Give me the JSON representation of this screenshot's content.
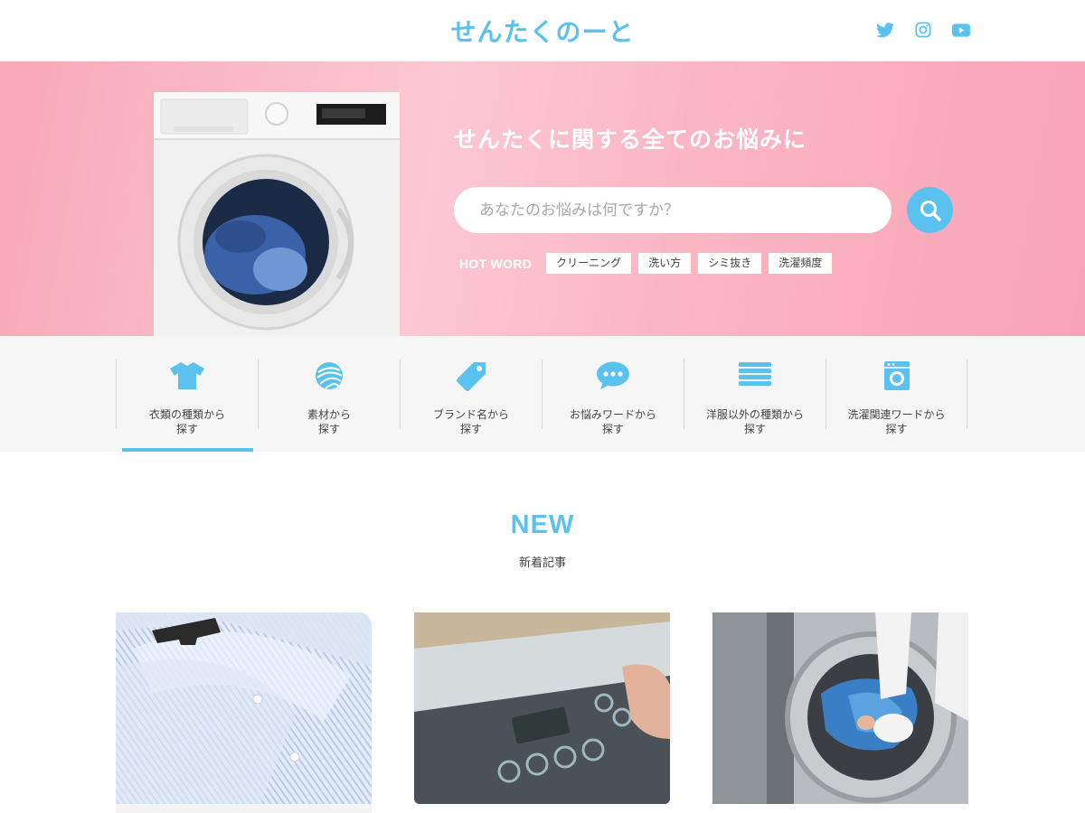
{
  "header": {
    "logo": "せんたくのーと",
    "social": [
      {
        "icon": "twitter-icon"
      },
      {
        "icon": "instagram-icon"
      },
      {
        "icon": "youtube-icon"
      }
    ]
  },
  "hero": {
    "title": "せんたくに関する全てのお悩みに",
    "search_placeholder": "あなたのお悩みは何ですか？",
    "hot_word_label": "HOT WORD",
    "hot_words": [
      "クリーニング",
      "洗い方",
      "シミ抜き",
      "洗濯頻度"
    ]
  },
  "categories": [
    {
      "icon": "tshirt-icon",
      "label": "衣類の種類から\n探す"
    },
    {
      "icon": "yarn-ball-icon",
      "label": "素材から\n探す"
    },
    {
      "icon": "tag-icon",
      "label": "ブランド名から\n探す"
    },
    {
      "icon": "chat-bubble-icon",
      "label": "お悩みワードから\n探す"
    },
    {
      "icon": "towel-stack-icon",
      "label": "洋服以外の種類から\n探す"
    },
    {
      "icon": "washing-machine-icon",
      "label": "洗濯関連ワードから\n探す"
    }
  ],
  "new_section": {
    "title": "NEW",
    "subtitle": "新着記事"
  },
  "colors": {
    "accent": "#5bc2f0",
    "hero_pink": "#f9b4c3",
    "nav_bg": "#f6f6f6"
  }
}
